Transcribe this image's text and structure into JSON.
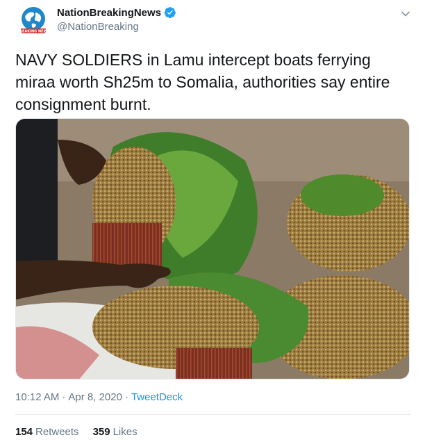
{
  "author": {
    "display_name": "NationBreakingNews",
    "handle": "@NationBreaking",
    "verified": true,
    "avatar_icon": "globe-logo-icon",
    "avatar_logo_text": "BREAKING NEWS"
  },
  "tweet": {
    "text": "NAVY SOLDIERS in Lamu intercept boats ferrying miraa worth Sh25m to Somalia, authorities say entire consignment burnt.",
    "media_icon": "photo-miraa-bundles",
    "time": "10:12 AM",
    "separator": "·",
    "date": "Apr 8, 2020",
    "source": "TweetDeck"
  },
  "stats": {
    "retweets_count": "154",
    "retweets_label": "Retweets",
    "likes_count": "359",
    "likes_label": "Likes"
  },
  "colors": {
    "verified": "#1da1f2",
    "link": "#1b95e0",
    "muted": "#657786",
    "text": "#14171a"
  }
}
